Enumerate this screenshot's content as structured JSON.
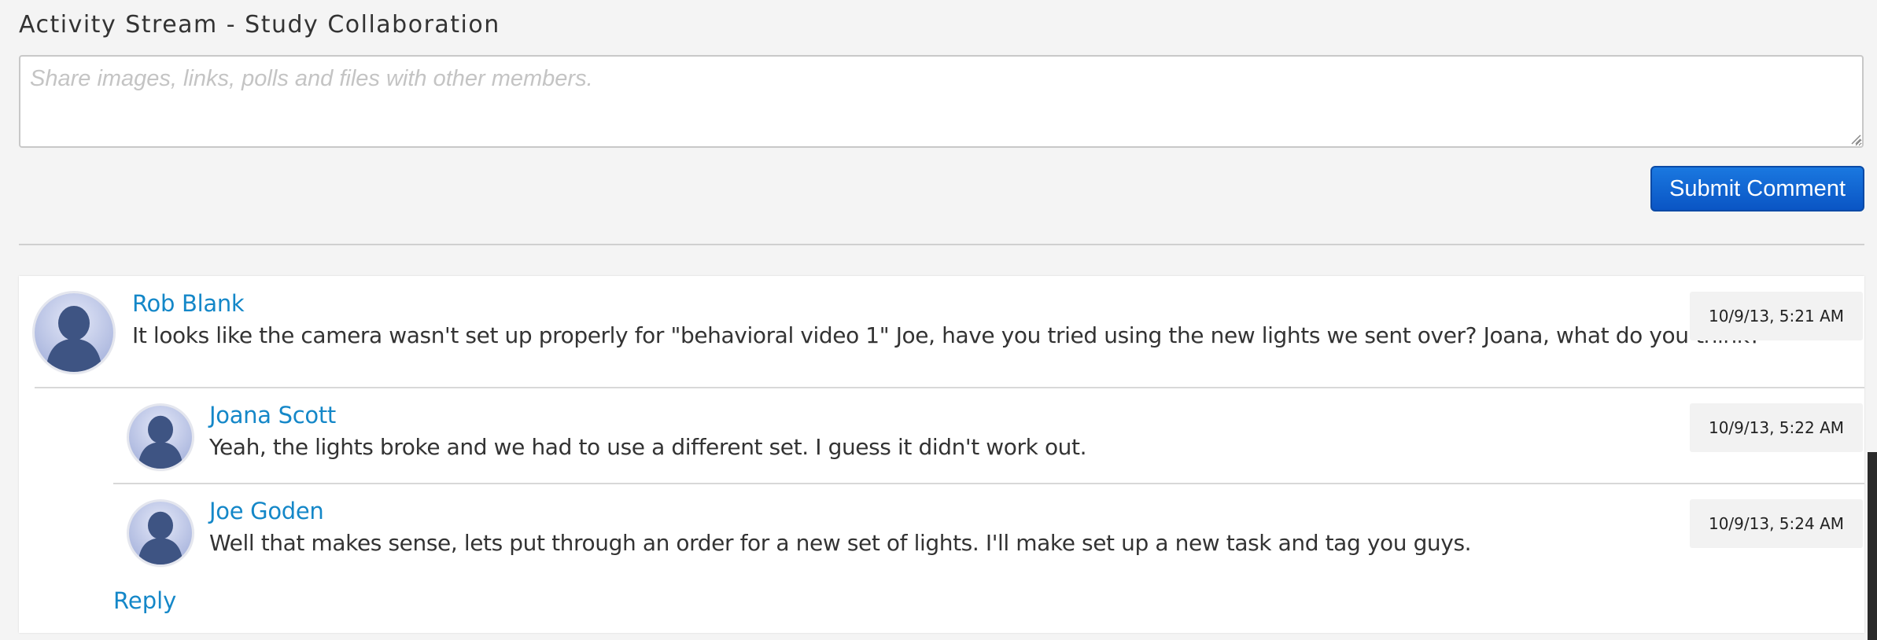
{
  "header": {
    "title": "Activity Stream - Study Collaboration"
  },
  "composer": {
    "placeholder": "Share images, links, polls and files with other members.",
    "value": "",
    "submit_label": "Submit Comment",
    "accent_color": "#0a55c4"
  },
  "thread": {
    "post": {
      "author": "Rob Blank",
      "text": "It looks like the camera wasn't set up properly for \"behavioral video 1\" Joe, have you tried using the new lights we sent over? Joana, what do you think?",
      "timestamp": "10/9/13, 5:21 AM",
      "avatar_icon": "person-silhouette-icon"
    },
    "replies": [
      {
        "author": "Joana Scott",
        "text": "Yeah, the lights broke and we had to use a different set. I guess it didn't work out.",
        "timestamp": "10/9/13, 5:22 AM",
        "avatar_icon": "person-silhouette-icon"
      },
      {
        "author": "Joe Goden",
        "text": "Well that makes sense, lets put through an order for a new set of lights. I'll make set up a new task and tag you guys.",
        "timestamp": "10/9/13, 5:24 AM",
        "avatar_icon": "person-silhouette-icon"
      }
    ],
    "reply_label": "Reply",
    "link_color": "#1487c8"
  }
}
